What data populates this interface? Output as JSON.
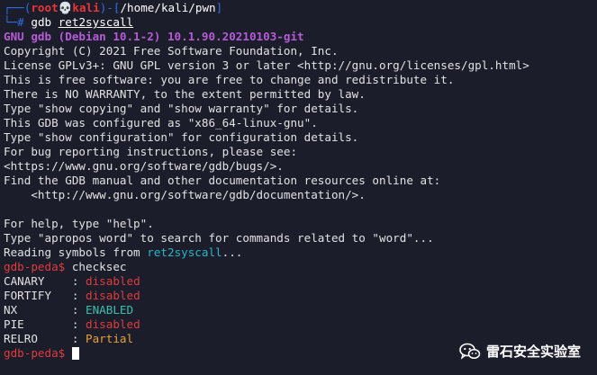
{
  "prompt": {
    "frame_open": "┌──(",
    "user": "root",
    "skull": "💀",
    "host": "kali",
    "path_open": ")-[",
    "path": "/home/kali/pwn",
    "path_close": "]",
    "frame_cmd": "└─",
    "symbol": "#",
    "command": "gdb",
    "argument": "ret2syscall"
  },
  "gdb_version": "GNU gdb (Debian 10.1-2) 10.1.90.20210103-git",
  "banner_lines": [
    "Copyright (C) 2021 Free Software Foundation, Inc.",
    "License GPLv3+: GNU GPL version 3 or later <http://gnu.org/licenses/gpl.html>",
    "This is free software: you are free to change and redistribute it.",
    "There is NO WARRANTY, to the extent permitted by law.",
    "Type \"show copying\" and \"show warranty\" for details.",
    "This GDB was configured as \"x86_64-linux-gnu\".",
    "Type \"show configuration\" for configuration details.",
    "For bug reporting instructions, please see:",
    "<https://www.gnu.org/software/gdb/bugs/>.",
    "Find the GDB manual and other documentation resources online at:",
    "    <http://www.gnu.org/software/gdb/documentation/>.",
    "",
    "For help, type \"help\".",
    "Type \"apropos word\" to search for commands related to \"word\"..."
  ],
  "reading": {
    "prefix": "Reading symbols from ",
    "file": "ret2syscall",
    "suffix": "..."
  },
  "peda_prompt": "gdb-peda$",
  "checksec_command": "checksec",
  "checksec": [
    {
      "name": "CANARY  ",
      "sep": "  : ",
      "value": "disabled",
      "color": "#e03b3b"
    },
    {
      "name": "FORTIFY ",
      "sep": "  : ",
      "value": "disabled",
      "color": "#e03b3b"
    },
    {
      "name": "NX      ",
      "sep": "  : ",
      "value": "ENABLED",
      "color": "#3bbfae"
    },
    {
      "name": "PIE     ",
      "sep": "  : ",
      "value": "disabled",
      "color": "#e03b3b"
    },
    {
      "name": "RELRO   ",
      "sep": "  : ",
      "value": "Partial",
      "color": "#e7a23a"
    }
  ],
  "watermark": {
    "text": "雷石安全实验室",
    "icon": "wechat-icon"
  }
}
